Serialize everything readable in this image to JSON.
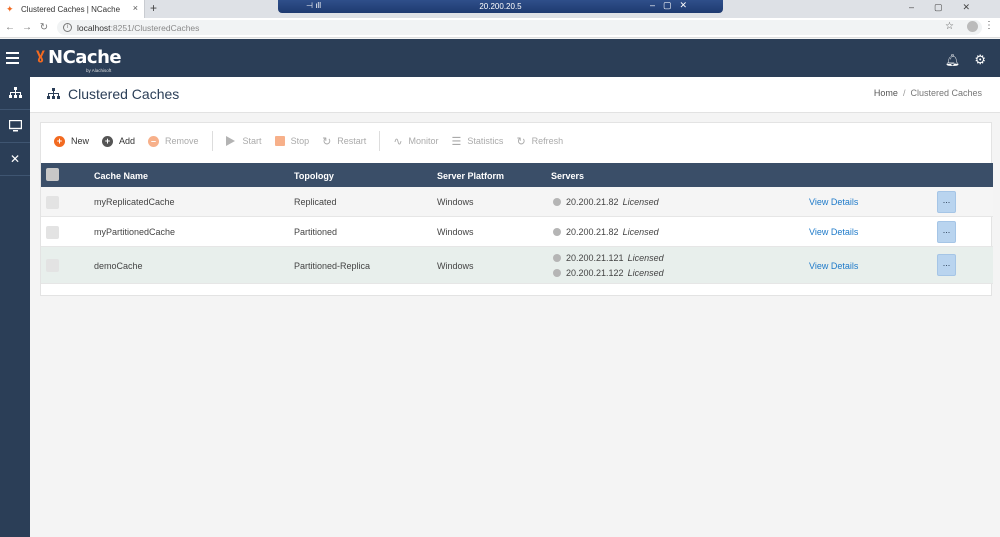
{
  "browser": {
    "tab_title": "Clustered Caches | NCache",
    "new_tab": "+",
    "tab_close": "×",
    "remote_host": "20.200.20.5",
    "url_host": "localhost",
    "url_path": ":8251/ClusteredCaches"
  },
  "app": {
    "logo_text": "NCache",
    "logo_by": "by Alachisoft"
  },
  "page": {
    "title": "Clustered Caches",
    "breadcrumb_home": "Home",
    "breadcrumb_sep": "/",
    "breadcrumb_current": "Clustered Caches"
  },
  "toolbar": {
    "new": "New",
    "add": "Add",
    "remove": "Remove",
    "start": "Start",
    "stop": "Stop",
    "restart": "Restart",
    "monitor": "Monitor",
    "statistics": "Statistics",
    "refresh": "Refresh"
  },
  "table": {
    "headers": {
      "cache_name": "Cache Name",
      "topology": "Topology",
      "platform": "Server Platform",
      "servers": "Servers"
    },
    "rows": [
      {
        "name": "myReplicatedCache",
        "topology": "Replicated",
        "platform": "Windows",
        "servers": [
          {
            "ip": "20.200.21.82",
            "status": "Licensed"
          }
        ],
        "details": "View Details",
        "more": "..."
      },
      {
        "name": "myPartitionedCache",
        "topology": "Partitioned",
        "platform": "Windows",
        "servers": [
          {
            "ip": "20.200.21.82",
            "status": "Licensed"
          }
        ],
        "details": "View Details",
        "more": "..."
      },
      {
        "name": "demoCache",
        "topology": "Partitioned-Replica",
        "platform": "Windows",
        "servers": [
          {
            "ip": "20.200.21.121",
            "status": "Licensed"
          },
          {
            "ip": "20.200.21.122",
            "status": "Licensed"
          }
        ],
        "details": "View Details",
        "more": "..."
      }
    ]
  },
  "colors": {
    "header_bg": "#2b3e57",
    "table_header_bg": "#3a4e68",
    "accent_orange": "#f26a21",
    "link_blue": "#1e7ac9"
  }
}
